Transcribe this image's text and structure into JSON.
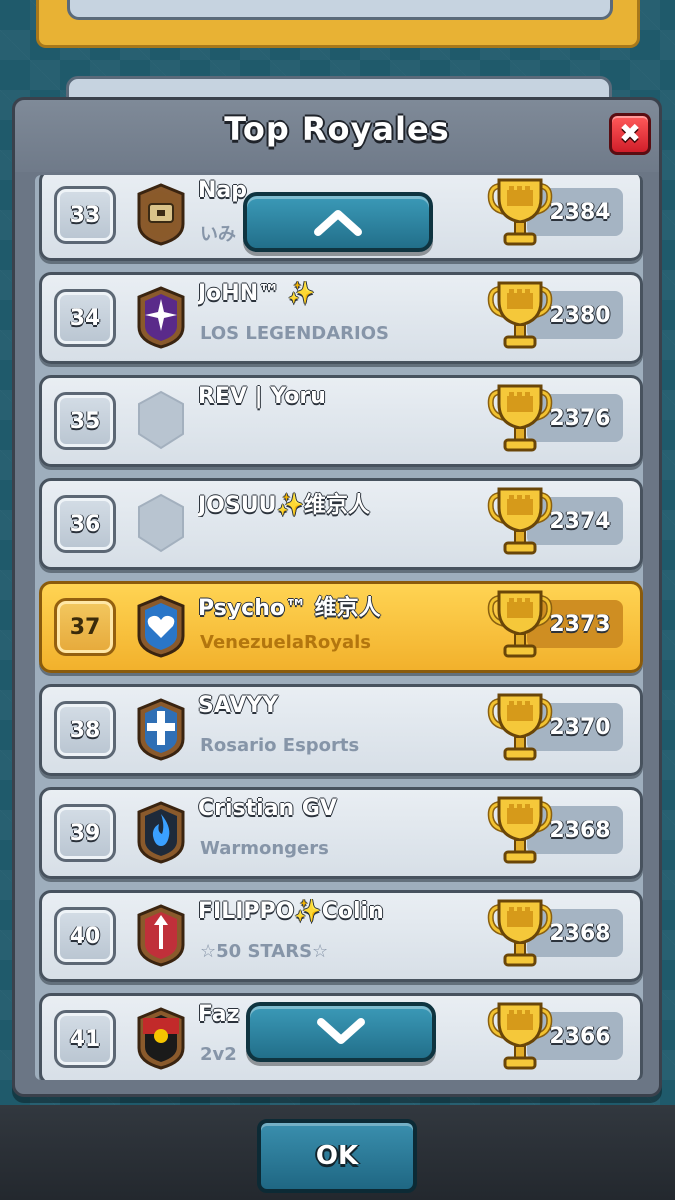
{
  "modal": {
    "title": "Top Royales",
    "close_label": "✖"
  },
  "rows": [
    {
      "rank": "33",
      "name": "Nap",
      "clan": "いみ",
      "trophies": "2384",
      "badge": "clan-badge-chest",
      "highlight": false
    },
    {
      "rank": "34",
      "name": "JoHN™ ✨",
      "clan": "LOS LEGENDARIOS",
      "trophies": "2380",
      "badge": "clan-badge-star",
      "highlight": false
    },
    {
      "rank": "35",
      "name": "REV |  Yoru",
      "clan": "",
      "trophies": "2376",
      "badge": "no-clan-badge",
      "highlight": false
    },
    {
      "rank": "36",
      "name": "JOSUU✨维京人",
      "clan": "",
      "trophies": "2374",
      "badge": "no-clan-badge",
      "highlight": false
    },
    {
      "rank": "37",
      "name": "Psycho™  维京人",
      "clan": "VenezuelaRoyals",
      "trophies": "2373",
      "badge": "clan-badge-heart",
      "highlight": true
    },
    {
      "rank": "38",
      "name": "SAVYY",
      "clan": "Rosario Esports",
      "trophies": "2370",
      "badge": "clan-badge-cross",
      "highlight": false
    },
    {
      "rank": "39",
      "name": "Cristian GV",
      "clan": "Warmongers",
      "trophies": "2368",
      "badge": "clan-badge-flame",
      "highlight": false
    },
    {
      "rank": "40",
      "name": "FILIPPO✨Colin",
      "clan": "☆50 STARS☆",
      "trophies": "2368",
      "badge": "clan-badge-arrow",
      "highlight": false
    },
    {
      "rank": "41",
      "name": "Faz",
      "clan": "2v2",
      "trophies": "2366",
      "badge": "clan-badge-sun",
      "highlight": false
    }
  ],
  "footer": {
    "ok_label": "OK"
  },
  "colors": {
    "highlight": "#f2b12c",
    "row": "#e3e9ef",
    "accent_blue": "#226f8a",
    "close_red": "#d01e2a"
  }
}
